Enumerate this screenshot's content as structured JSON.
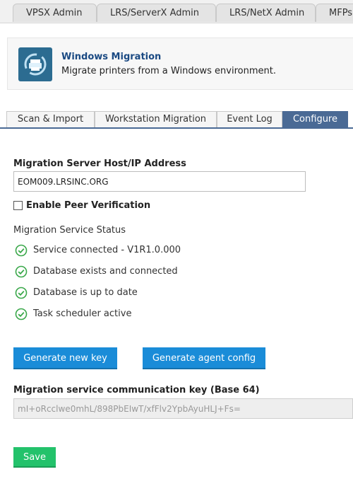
{
  "top_tabs": [
    "VPSX Admin",
    "LRS/ServerX Admin",
    "LRS/NetX Admin",
    "MFPs"
  ],
  "header": {
    "title": "Windows Migration",
    "subtitle": "Migrate printers from a Windows environment.",
    "icon": "printer-migration-icon"
  },
  "sub_tabs": [
    "Scan & Import",
    "Workstation Migration",
    "Event Log",
    "Configure"
  ],
  "form": {
    "server_label": "Migration Server Host/IP Address",
    "server_value": "EOM009.LRSINC.ORG",
    "peer_verification_label": "Enable Peer Verification",
    "status_heading": "Migration Service Status",
    "status_items": [
      "Service connected - V1R1.0.000",
      "Database exists and connected",
      "Database is up to date",
      "Task scheduler active"
    ],
    "generate_key_label": "Generate new key",
    "generate_config_label": "Generate agent config",
    "key_label": "Migration service communication key (Base 64)",
    "key_value": "mI+oRcclwe0mhL/898PbEIwT/xfFlv2YpbAyuHLJ+Fs=",
    "save_label": "Save"
  },
  "colors": {
    "accent_blue": "#1a8cd8",
    "active_tab": "#4a6a95",
    "save_green": "#23c26b",
    "status_ok": "#3aa84a"
  }
}
